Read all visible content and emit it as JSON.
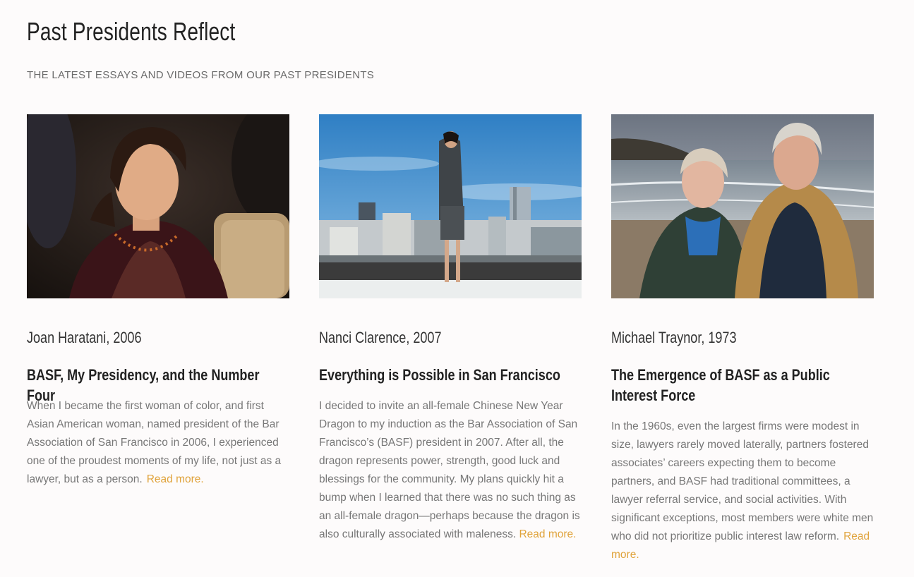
{
  "header": {
    "title": "Past Presidents Reflect",
    "subtitle": "THE LATEST ESSAYS AND VIDEOS FROM OUR PAST PRESIDENTS"
  },
  "colors": {
    "background": "#fdfbfb",
    "read_more": "#e0a33b",
    "body_text": "#777777",
    "heading": "#222222"
  },
  "cards": [
    {
      "author": "Joan Haratani, 2006",
      "title": "BASF, My Presidency, and the Number Four",
      "excerpt": "When I became the first woman of color, and first Asian American woman, named president of the Bar Association of San Francisco in 2006, I experienced one of the proudest moments of my life, not just as a lawyer, but as a person.",
      "read_more": "Read more."
    },
    {
      "author": "Nanci Clarence, 2007",
      "title": "Everything is Possible in San Francisco",
      "excerpt": "I decided to invite an all-female Chinese New Year Dragon to my induction as the Bar Association of San Francisco’s (BASF) president in 2007. After all, the dragon represents power, strength, good luck and blessings for the community. My plans quickly hit a bump when I learned that there was no such thing as an all-female dragon—perhaps because the dragon is also culturally associated with maleness.",
      "read_more": "Read more."
    },
    {
      "author": "Michael Traynor, 1973",
      "title": "The Emergence of BASF as a Public Interest Force",
      "excerpt": "In the 1960s, even the largest firms were modest in size, lawyers rarely moved laterally, partners fostered associates’ careers expecting them to become partners, and BASF had traditional committees, a lawyer referral service, and social activities. With significant exceptions, most members were white men who did not prioritize public interest law reform.",
      "read_more": "Read more."
    }
  ]
}
